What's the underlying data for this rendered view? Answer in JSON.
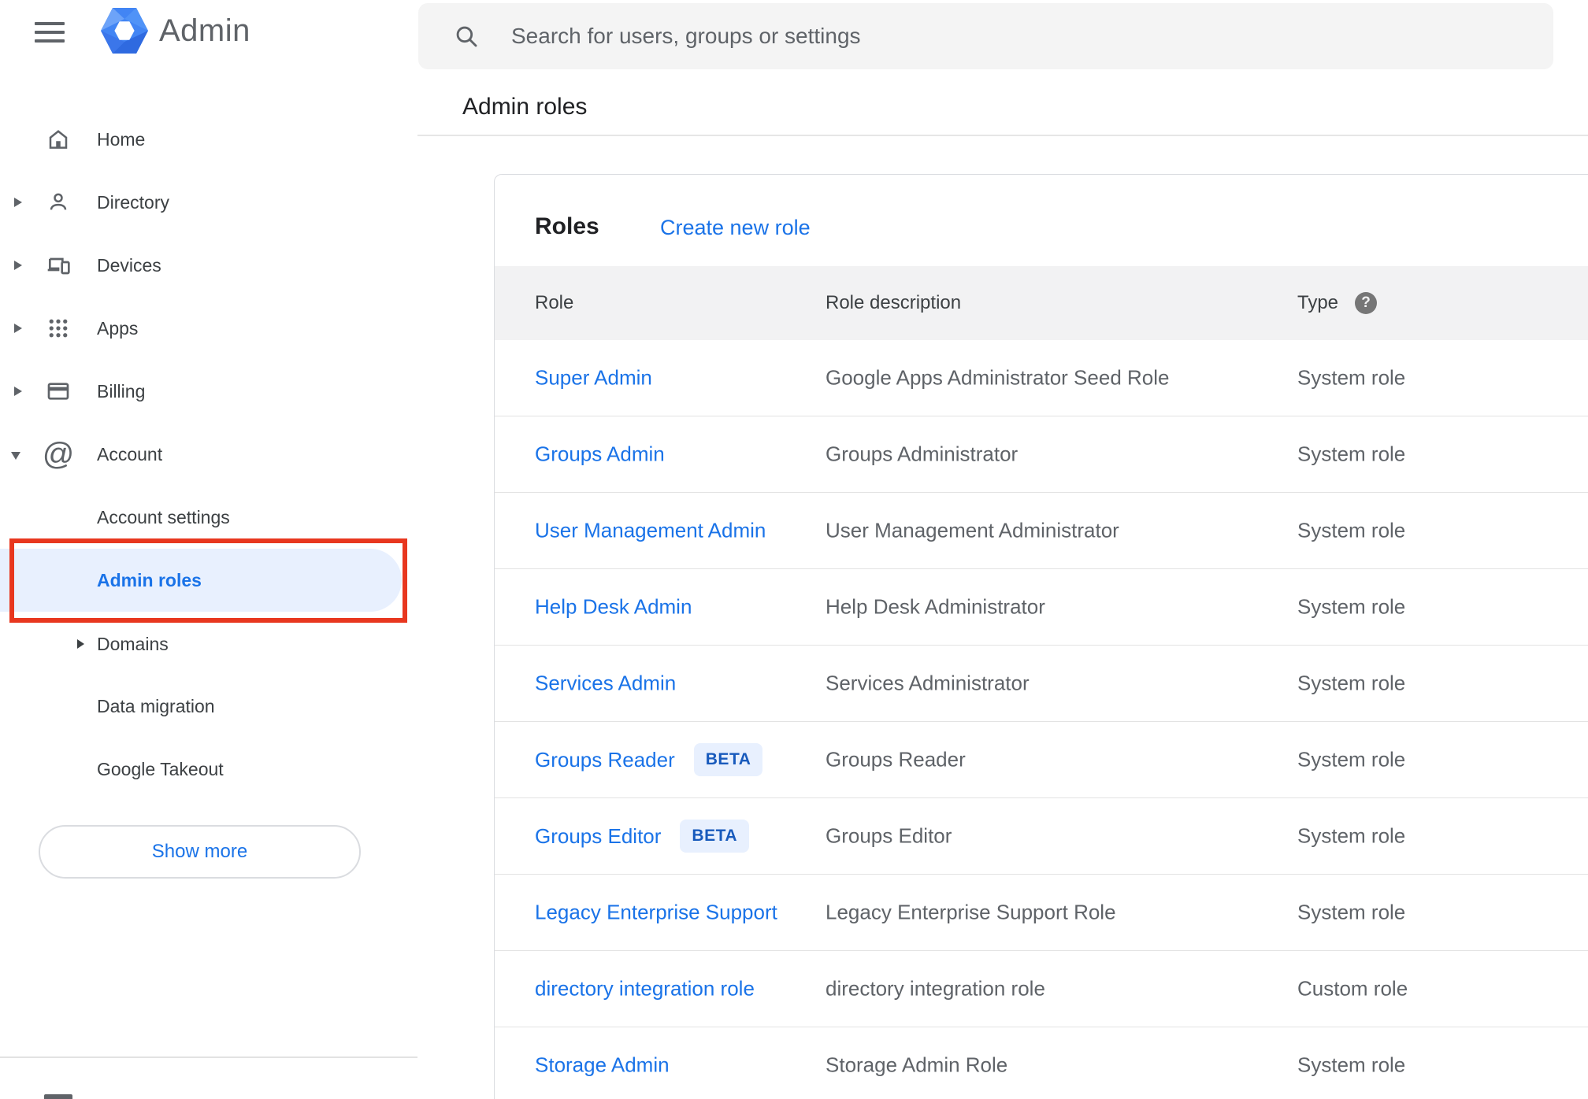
{
  "app": {
    "title": "Admin"
  },
  "search": {
    "placeholder": "Search for users, groups or settings"
  },
  "breadcrumb": "Admin roles",
  "sidebar": {
    "items": [
      {
        "label": "Home",
        "icon": "home-icon",
        "expandable": false
      },
      {
        "label": "Directory",
        "icon": "person-icon",
        "expandable": true
      },
      {
        "label": "Devices",
        "icon": "devices-icon",
        "expandable": true
      },
      {
        "label": "Apps",
        "icon": "apps-grid-icon",
        "expandable": true
      },
      {
        "label": "Billing",
        "icon": "credit-card-icon",
        "expandable": true
      },
      {
        "label": "Account",
        "icon": "at-sign-icon",
        "expandable": true,
        "expanded": true,
        "at_glyph": "@"
      }
    ],
    "account_subitems": [
      {
        "label": "Account settings"
      },
      {
        "label": "Admin roles",
        "active": true,
        "annotated": true
      },
      {
        "label": "Domains",
        "expandable": true
      },
      {
        "label": "Data migration"
      },
      {
        "label": "Google Takeout"
      }
    ],
    "show_more_label": "Show more"
  },
  "main": {
    "card_title": "Roles",
    "create_link": "Create new role",
    "table": {
      "columns": [
        "Role",
        "Role description",
        "Type"
      ],
      "help_glyph": "?",
      "rows": [
        {
          "role": "Super Admin",
          "description": "Google Apps Administrator Seed Role",
          "type": "System role"
        },
        {
          "role": "Groups Admin",
          "description": "Groups Administrator",
          "type": "System role"
        },
        {
          "role": "User Management Admin",
          "description": "User Management Administrator",
          "type": "System role"
        },
        {
          "role": "Help Desk Admin",
          "description": "Help Desk Administrator",
          "type": "System role"
        },
        {
          "role": "Services Admin",
          "description": "Services Administrator",
          "type": "System role"
        },
        {
          "role": "Groups Reader",
          "beta_label": "BETA",
          "description": "Groups Reader",
          "type": "System role"
        },
        {
          "role": "Groups Editor",
          "beta_label": "BETA",
          "description": "Groups Editor",
          "type": "System role"
        },
        {
          "role": "Legacy Enterprise Support",
          "description": "Legacy Enterprise Support Role",
          "type": "System role"
        },
        {
          "role": "directory integration role",
          "description": "directory integration role",
          "type": "Custom role"
        },
        {
          "role": "Storage Admin",
          "description": "Storage Admin Role",
          "type": "System role"
        }
      ]
    }
  },
  "colors": {
    "accent": "#1a73e8",
    "active_item_bg": "#e8f0fe",
    "annotation_red": "#e8371f",
    "beta_badge_bg": "#e8f0fe",
    "beta_badge_text": "#185abc",
    "table_header_bg": "#f2f2f3",
    "search_bar_bg": "#f4f4f4"
  }
}
